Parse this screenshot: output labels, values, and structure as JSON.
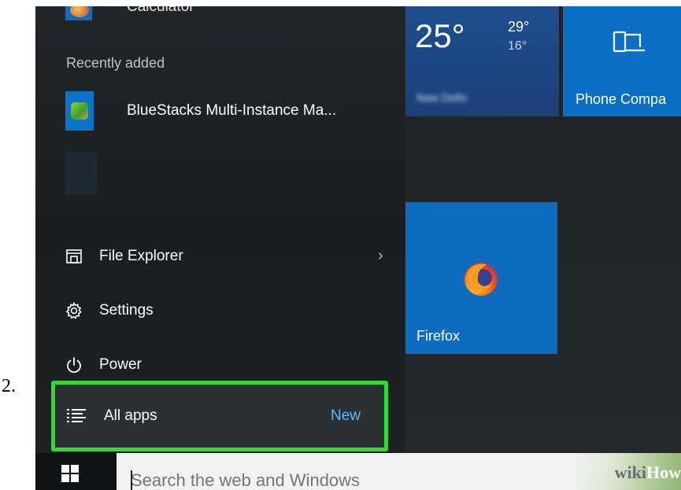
{
  "annotation": {
    "step_number": "2."
  },
  "start_menu": {
    "top_app": {
      "label": "Calculator",
      "icon": "calculator-icon"
    },
    "recently_added": {
      "heading": "Recently added",
      "items": [
        {
          "label": "BlueStacks Multi-Instance Ma...",
          "icon": "bluestacks-icon"
        }
      ]
    },
    "nav": {
      "file_explorer": {
        "label": "File Explorer",
        "icon": "folder-icon",
        "chevron": "›"
      },
      "settings": {
        "label": "Settings",
        "icon": "gear-icon"
      },
      "power": {
        "label": "Power",
        "icon": "power-icon"
      }
    },
    "all_apps": {
      "label": "All apps",
      "badge": "New",
      "icon": "list-icon",
      "highlight_color": "#2fdc2f"
    }
  },
  "tiles": {
    "weather": {
      "temp": "25°",
      "high": "29°",
      "low": "16°",
      "city": "New Delhi"
    },
    "phone_companion": {
      "label": "Phone Compa",
      "icon": "phone-laptop-icon"
    },
    "firefox": {
      "label": "Firefox",
      "icon": "firefox-icon"
    }
  },
  "taskbar": {
    "start_icon": "windows-logo-icon",
    "search": {
      "placeholder": "Search the web and Windows"
    },
    "watermark": {
      "text_a": "wiki",
      "text_b": "How"
    }
  },
  "colors": {
    "accent": "#0b6fc6",
    "background": "#1d2226",
    "link_blue": "#5fb8ff"
  }
}
